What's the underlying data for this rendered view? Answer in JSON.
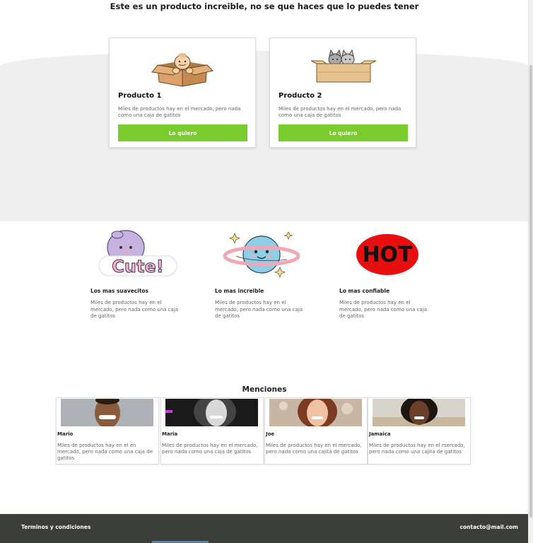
{
  "hero": {
    "headline": "Este es un producto increible, no se que haces que lo puedes tener"
  },
  "products": [
    {
      "title": "Producto 1",
      "description": "Miles de productos hay en el mercado, pero nada como una caja de gatitos",
      "cta": "Lo quiero",
      "icon": "baby-in-box-icon"
    },
    {
      "title": "Producto 2",
      "description": "Miles de productos hay en el mercado, pero nada como una caja de gatitos",
      "cta": "Lo quiero",
      "icon": "cats-in-box-icon"
    }
  ],
  "features": [
    {
      "title": "Los mas suavecitos",
      "description": "Miles de productos hay en el mercado, pero nada como una caja de gatitos",
      "icon": "cute-sticker-icon",
      "sticker_text": "Cute!"
    },
    {
      "title": "Lo mas increible",
      "description": "Miles de productos hay en el mercado, pero nada como una caja de gatitos",
      "icon": "smiling-planet-icon"
    },
    {
      "title": "Lo mas confiable",
      "description": "Miles de productos hay en el mercado, pero nada como una caja de gatitos",
      "icon": "hot-sticker-icon",
      "sticker_text": "HOT"
    }
  ],
  "mentions": {
    "title": "Menciones",
    "people": [
      {
        "name": "Mario",
        "description": "Miles de productos hay en el en mercado, pero nada como una caja de gatitos"
      },
      {
        "name": "Maria",
        "description": "Miles de productos hay en el mercado, pero nada como una caja de gatitos"
      },
      {
        "name": "Joe",
        "description": "Miles de productos hay en el mercado, pero nada como una cajita de gatitos"
      },
      {
        "name": "Jamaica",
        "description": "Miles de productos hay en el mercado, pero nada como una cajita de gatitos"
      }
    ]
  },
  "footer": {
    "terms": "Terminos y condiciones",
    "email": "contacto@mail.com"
  },
  "colors": {
    "accent_green": "#7acb2e",
    "footer_bg": "#3b3d38",
    "band_gray": "#efefef"
  }
}
